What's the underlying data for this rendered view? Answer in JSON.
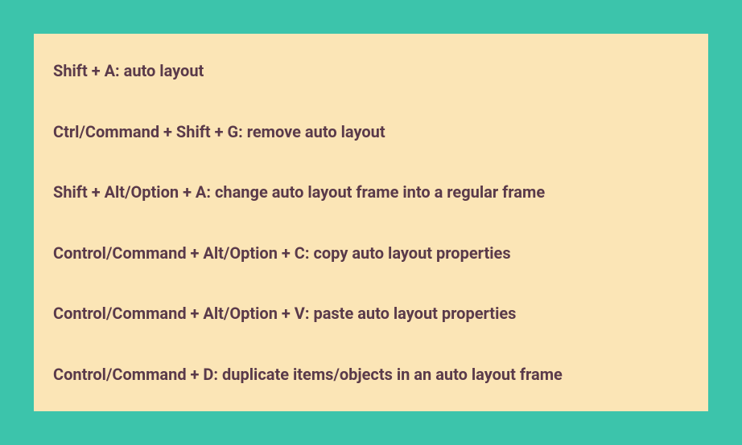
{
  "shortcuts": [
    {
      "text": "Shift + A: auto layout"
    },
    {
      "text": "Ctrl/Command + Shift + G: remove auto layout"
    },
    {
      "text": "Shift + Alt/Option + A: change auto layout frame into a regular frame"
    },
    {
      "text": "Control/Command + Alt/Option + C: copy auto layout properties"
    },
    {
      "text": "Control/Command + Alt/Option + V: paste auto layout properties"
    },
    {
      "text": "Control/Command + D: duplicate items/objects in an auto layout frame"
    }
  ]
}
